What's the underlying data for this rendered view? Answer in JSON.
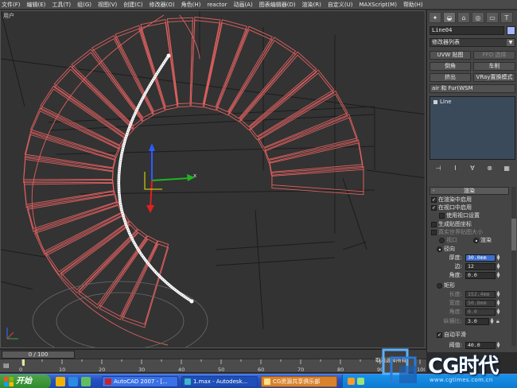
{
  "menubar": {
    "items": [
      "文件(F)",
      "编辑(E)",
      "工具(T)",
      "组(G)",
      "视图(V)",
      "创建(C)",
      "修改器(O)",
      "角色(H)",
      "reactor",
      "动画(A)",
      "图表编辑器(D)",
      "渲染(R)",
      "自定义(U)",
      "MAXScript(M)",
      "帮助(H)"
    ]
  },
  "viewport": {
    "label": "用户"
  },
  "command_panel": {
    "object_name": "Line04",
    "object_color": "#a4b8ff",
    "modifier_list": "修改器列表",
    "buttons": {
      "uvw": "UVW 贴图",
      "ffd": "FFD 选择",
      "chamfer": "倒角",
      "lathe": "车削",
      "extrude": "挤出",
      "vray_disp": "VRay置换模式",
      "hair": "air 和 Fur(WSM"
    },
    "stack_item": "Line",
    "stack_tools": [
      "⊣",
      "I",
      "∀",
      "⊗",
      "▦"
    ],
    "rollout_title": "渲染",
    "render_enable": "在渲染中启用",
    "viewport_enable": "在视口中启用",
    "use_viewport_settings": "使用视口设置",
    "gen_mapping": "生成贴图坐标",
    "real_world": "真实世界贴图大小",
    "radio_viewport": "视口",
    "radio_render": "渲染",
    "radial_label": "径向",
    "thickness_label": "厚度:",
    "thickness_value": "30.0mm",
    "sides_label": "边:",
    "sides_value": "12",
    "angle_label": "角度:",
    "angle_value": "0.0",
    "rect_label": "矩形",
    "length_label": "长度:",
    "length_value": "152.4mm",
    "width_label": "宽度:",
    "width_value": "50.8mm",
    "rect_angle_label": "角度:",
    "rect_angle_value": "0.0",
    "aspect_label": "纵横比:",
    "aspect_value": "3.0",
    "auto_smooth": "自动平滑",
    "threshold_label": "阈值:",
    "threshold_value": "40.0"
  },
  "timeline": {
    "slider_label": "0 / 100",
    "ticks": [
      "0",
      "10",
      "20",
      "30",
      "40",
      "50",
      "60",
      "70",
      "80",
      "90",
      "100"
    ],
    "prompt": "取消选择所有"
  },
  "taskbar": {
    "start_label": "开始",
    "tasks": [
      "AutoCAD 2007 - [...",
      "1.max - Autodesk...",
      "CG资源共享俱乐部"
    ]
  },
  "watermark": {
    "brand": "CG时代",
    "url": "www.cgtimes.com.cn"
  }
}
